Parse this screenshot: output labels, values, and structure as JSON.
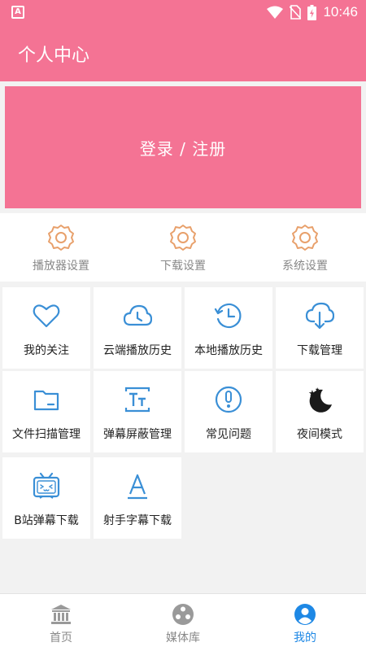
{
  "status_bar": {
    "app_badge": "A",
    "time": "10:46"
  },
  "header": {
    "title": "个人中心"
  },
  "login": {
    "label": "登录 / 注册"
  },
  "settings": [
    {
      "label": "播放器设置",
      "icon": "gear-icon"
    },
    {
      "label": "下载设置",
      "icon": "gear-icon"
    },
    {
      "label": "系统设置",
      "icon": "gear-icon"
    }
  ],
  "grid": [
    {
      "label": "我的关注",
      "icon": "heart-icon"
    },
    {
      "label": "云端播放历史",
      "icon": "cloud-clock-icon"
    },
    {
      "label": "本地播放历史",
      "icon": "history-clock-icon"
    },
    {
      "label": "下载管理",
      "icon": "cloud-download-icon"
    },
    {
      "label": "文件扫描管理",
      "icon": "folder-icon"
    },
    {
      "label": "弹幕屏蔽管理",
      "icon": "text-block-icon"
    },
    {
      "label": "常见问题",
      "icon": "exclamation-circle-icon"
    },
    {
      "label": "夜间模式",
      "icon": "moon-stars-icon"
    },
    {
      "label": "B站弹幕下载",
      "icon": "tv-icon"
    },
    {
      "label": "射手字幕下载",
      "icon": "letter-a-icon"
    }
  ],
  "nav": [
    {
      "label": "首页",
      "icon": "bank-icon"
    },
    {
      "label": "媒体库",
      "icon": "media-reel-icon"
    },
    {
      "label": "我的",
      "icon": "user-icon",
      "active": true
    }
  ],
  "colors": {
    "primary": "#f47394",
    "icon_blue": "#3a8fd6",
    "icon_orange": "#e8a06b",
    "active": "#1e88e5"
  }
}
